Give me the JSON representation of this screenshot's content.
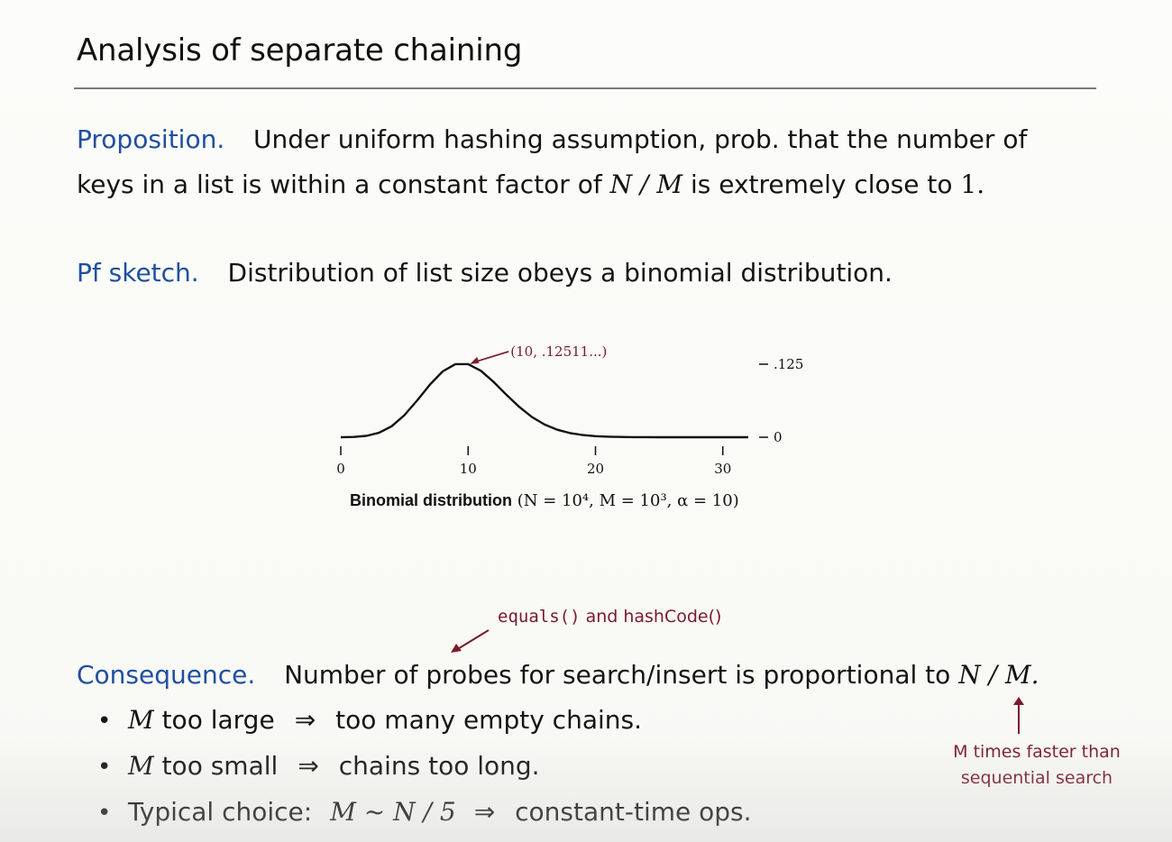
{
  "slide": {
    "title": "Analysis of separate chaining",
    "proposition": {
      "lead": "Proposition.",
      "text_a": "Under uniform hashing assumption, prob. that the number of",
      "text_b": "keys in a list is within a constant factor of",
      "math_nm": "N / M",
      "text_c": "is extremely close to",
      "one": "1."
    },
    "pf_sketch": {
      "lead": "Pf sketch.",
      "text": "Distribution of list size obeys a binomial distribution."
    },
    "chart_caption": {
      "label": "Binomial distribution",
      "formula": "(N = 10⁴, M = 10³, α = 10)"
    },
    "note_top": {
      "code": "equals()",
      "text": "and hashCode()"
    },
    "consequence": {
      "lead": "Consequence.",
      "text": "Number of probes for search/insert is proportional to",
      "math_nm": "N / M."
    },
    "bullets": [
      {
        "math": "M",
        "a": "too large",
        "arrow": "⇒",
        "b": "too many empty chains."
      },
      {
        "math": "M",
        "a": "too small",
        "arrow": "⇒",
        "b": "chains too long."
      },
      {
        "text": "Typical choice:",
        "math": "M ~ N / 5",
        "arrow": "⇒",
        "b": "constant-time ops."
      }
    ],
    "note_right": {
      "line1": "M times faster than",
      "line2": "sequential search"
    }
  },
  "chart_data": {
    "type": "line",
    "title": "",
    "xlabel": "",
    "ylabel": "",
    "x_ticks": [
      "0",
      "10",
      "20",
      "30"
    ],
    "y_ticks": [
      ".125",
      "0"
    ],
    "xlim": [
      0,
      32
    ],
    "ylim": [
      0,
      0.125
    ],
    "annotation": {
      "label": "(10, .12511...)",
      "x": 10,
      "y": 0.12511
    },
    "series": [
      {
        "x": [
          0,
          1,
          2,
          3,
          4,
          5,
          6,
          7,
          8,
          9,
          10,
          11,
          12,
          13,
          14,
          15,
          16,
          17,
          18,
          19,
          20,
          21,
          22,
          23,
          24,
          25,
          26,
          27,
          28,
          29,
          30,
          31,
          32
        ],
        "values": [
          4.54e-05,
          0.000454,
          0.00227,
          0.00757,
          0.0189,
          0.0378,
          0.0631,
          0.0901,
          0.1126,
          0.1251,
          0.1251,
          0.1137,
          0.0948,
          0.0729,
          0.0521,
          0.0347,
          0.0217,
          0.0128,
          0.0071,
          0.0037,
          0.0019,
          0.0009,
          0.0004,
          0.0002,
          0.0001,
          4e-05,
          2e-05,
          1e-05,
          0,
          0,
          0,
          0,
          0
        ]
      }
    ]
  }
}
